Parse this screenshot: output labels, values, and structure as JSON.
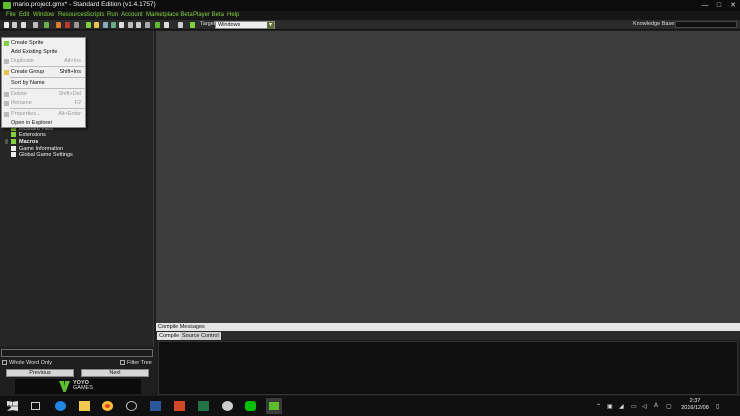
{
  "window": {
    "title": "mario.project.gmx* - Standard Edition (v1.4.1757)",
    "controls": [
      "—",
      "□",
      "✕"
    ]
  },
  "menubar": [
    "File",
    "Edit",
    "Window",
    "Resources",
    "Scripts",
    "Run",
    "Account",
    "Marketplace Beta",
    "Player Beta",
    "Help"
  ],
  "toolbar": {
    "target_label": "Target",
    "target_value": "Windows",
    "knowledge_base_label": "Knowledge Base:",
    "knowledge_base_value": ""
  },
  "tree": {
    "visible_items": [
      "Included Files",
      "Extensions",
      "Macros",
      "Game Information",
      "Global Game Settings"
    ]
  },
  "context_menu": {
    "items": [
      {
        "label": "Create Sprite",
        "shortcut": "",
        "enabled": true
      },
      {
        "label": "Add Existing Sprite",
        "shortcut": "",
        "enabled": true
      },
      {
        "label": "Duplicate",
        "shortcut": "Alt+Ins",
        "enabled": false
      },
      {
        "label": "Create Group",
        "shortcut": "Shift+Ins",
        "enabled": true
      },
      {
        "label": "Sort by Name",
        "shortcut": "",
        "enabled": true
      },
      {
        "label": "Delete",
        "shortcut": "Shift+Del",
        "enabled": false
      },
      {
        "label": "Rename",
        "shortcut": "F2",
        "enabled": false
      },
      {
        "label": "Properties...",
        "shortcut": "Alt+Enter",
        "enabled": false
      },
      {
        "label": "Open in Explorer",
        "shortcut": "",
        "enabled": true
      }
    ]
  },
  "search": {
    "placeholder": "",
    "whole_word_label": "Whole Word Only",
    "filter_tree_label": "Filter Tree",
    "previous_label": "Previous",
    "next_label": "Next"
  },
  "branding": {
    "line1": "YOYO",
    "line2": "GAMES"
  },
  "compile": {
    "header": "Compile Messages",
    "tabs": [
      "Compile",
      "Source Control"
    ]
  },
  "taskbar": {
    "time": "2:37",
    "date": "2016/12/08",
    "ime": "A"
  },
  "colors": {
    "accent": "#7fd13b",
    "gm_green": "#5bbf2a"
  }
}
